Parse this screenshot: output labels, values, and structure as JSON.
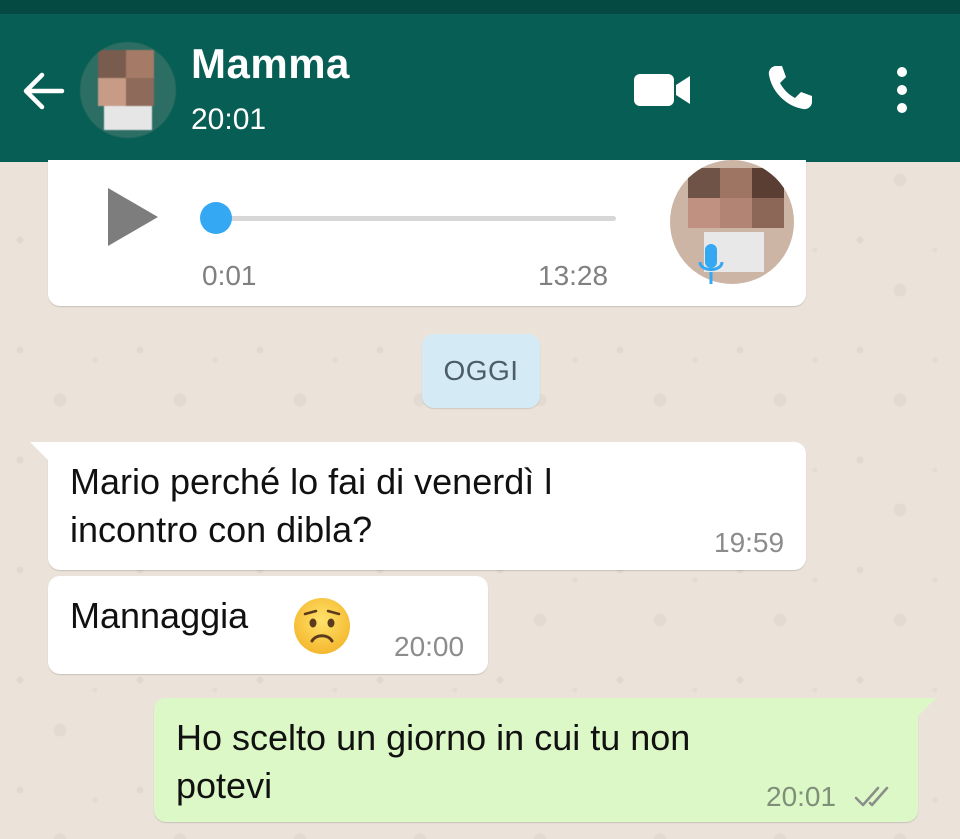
{
  "header": {
    "contact_name": "Mamma",
    "last_seen": "20:01",
    "icons": [
      "back-arrow-icon",
      "video-call-icon",
      "phone-call-icon",
      "more-options-icon"
    ],
    "color": "#075e54"
  },
  "audio_message": {
    "duration": "0:01",
    "time": "13:28",
    "progress": 0.0,
    "icons": [
      "play-icon",
      "microphone-icon"
    ]
  },
  "date_divider": {
    "label": "OGGI"
  },
  "messages": [
    {
      "direction": "incoming",
      "lines": [
        "Mario perché  lo fai di venerdì l",
        "incontro con dibla?"
      ],
      "time": "19:59"
    },
    {
      "direction": "incoming",
      "text": "Mannaggia",
      "emoji": "worried-face",
      "time": "20:00"
    },
    {
      "direction": "outgoing",
      "lines": [
        "Ho scelto un giorno in cui tu non",
        "potevi"
      ],
      "time": "20:01",
      "status": "read-double-check"
    }
  ],
  "colors": {
    "incoming_bubble": "#ffffff",
    "outgoing_bubble": "#dcf8c6",
    "date_chip": "#d4eaf4",
    "audio_accent": "#34a8f2"
  }
}
